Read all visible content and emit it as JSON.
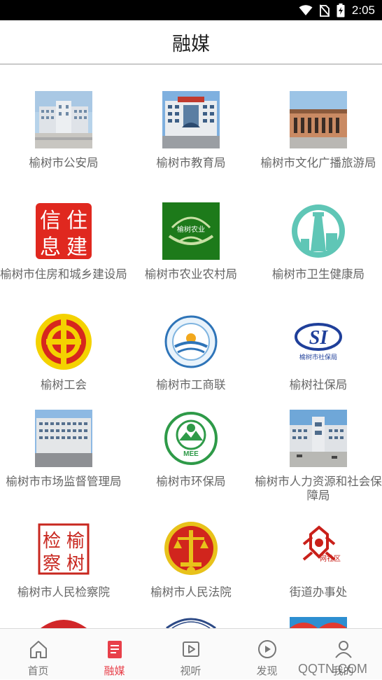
{
  "status_bar": {
    "time": "2:05",
    "icons": [
      "wifi-icon",
      "no-sim-icon",
      "battery-charging-icon"
    ]
  },
  "header": {
    "title": "融媒"
  },
  "grid": [
    {
      "label": "榆树市公安局",
      "icon": "government-building-photo"
    },
    {
      "label": "榆树市教育局",
      "icon": "education-building-photo"
    },
    {
      "label": "榆树市文化广播旅游局",
      "icon": "culture-building-photo"
    },
    {
      "label": "榆树市住房和城乡建设局",
      "icon": "housing-seal-logo",
      "seal_chars": [
        "信",
        "住",
        "息",
        "建"
      ]
    },
    {
      "label": "榆树市农业农村局",
      "icon": "agriculture-logo",
      "logo_text": "榆树农业"
    },
    {
      "label": "榆树市卫生健康局",
      "icon": "health-tower-logo"
    },
    {
      "label": "榆树工会",
      "icon": "trade-union-logo"
    },
    {
      "label": "榆树市工商联",
      "icon": "commerce-federation-logo"
    },
    {
      "label": "榆树社保局",
      "icon": "social-security-logo",
      "logo_text": "榆树市社保局",
      "logo_mark": "SI"
    },
    {
      "label": "榆树市市场监督管理局",
      "icon": "market-supervision-building-photo"
    },
    {
      "label": "榆树市环保局",
      "icon": "environment-mee-logo",
      "logo_text": "MEE"
    },
    {
      "label": "榆树市人力资源和社会保障局",
      "icon": "hr-building-photo"
    },
    {
      "label": "榆树市人民检察院",
      "icon": "procuratorate-seal-logo",
      "seal_chars": [
        "检",
        "榆",
        "察",
        "树"
      ]
    },
    {
      "label": "榆树市人民法院",
      "icon": "court-emblem-logo"
    },
    {
      "label": "街道办事处",
      "icon": "community-logo",
      "logo_text": "网社区"
    }
  ],
  "tabs": [
    {
      "label": "首页",
      "icon": "home-icon",
      "active": false
    },
    {
      "label": "融媒",
      "icon": "media-document-icon",
      "active": true
    },
    {
      "label": "视听",
      "icon": "video-icon",
      "active": false
    },
    {
      "label": "发现",
      "icon": "discover-play-icon",
      "active": false
    },
    {
      "label": "我的",
      "icon": "user-icon",
      "active": false
    }
  ],
  "watermark": "QQTN.COM",
  "colors": {
    "accent": "#e8404a",
    "label_gray": "#666666",
    "tab_gray": "#777777"
  }
}
